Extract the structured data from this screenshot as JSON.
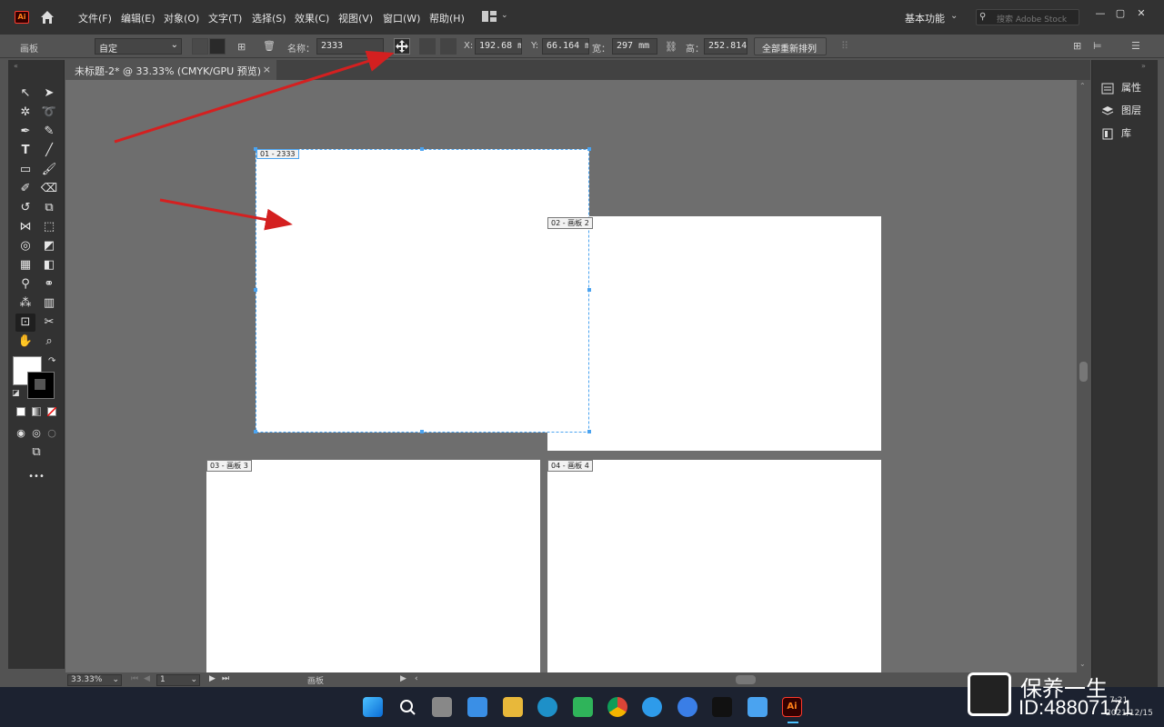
{
  "app": {
    "logo_text": "Ai",
    "menu": [
      "文件(F)",
      "编辑(E)",
      "对象(O)",
      "文字(T)",
      "选择(S)",
      "效果(C)",
      "视图(V)",
      "窗口(W)",
      "帮助(H)"
    ],
    "workspace": "基本功能",
    "search_placeholder": "搜索 Adobe Stock"
  },
  "control_bar": {
    "mode_label": "画板",
    "preset": "自定",
    "name_label": "名称：",
    "name_value": "2333",
    "x_label": "X:",
    "x_value": "192.68 m",
    "y_label": "Y:",
    "y_value": "66.164 m",
    "w_label": "宽：",
    "w_value": "297 mm",
    "h_label": "高：",
    "h_value": "252.814",
    "rearrange_button": "全部重新排列"
  },
  "document": {
    "tab_title": "未标题-2* @ 33.33% (CMYK/GPU 预览)",
    "tab_close": "×"
  },
  "artboards": [
    {
      "label": "01 - 2333",
      "selected": true
    },
    {
      "label": "02 - 画板 2",
      "selected": false
    },
    {
      "label": "03 - 画板 3",
      "selected": false
    },
    {
      "label": "04 - 画板 4",
      "selected": false
    }
  ],
  "status": {
    "zoom": "33.33%",
    "artboard_number": "1",
    "tool_name": "画板"
  },
  "right_panel": {
    "items": [
      "属性",
      "图层",
      "库"
    ]
  },
  "toolbar": {
    "more": "•••"
  },
  "watermark": {
    "line1": "保养一生",
    "line2": "ID:48807171"
  },
  "system_tray": {
    "time": "7:21",
    "date": "2021/12/15"
  },
  "colors": {
    "accent_red_arrow": "#d42020",
    "selection_blue": "#4aa3f0",
    "canvas_bg": "#6e6e6e"
  }
}
